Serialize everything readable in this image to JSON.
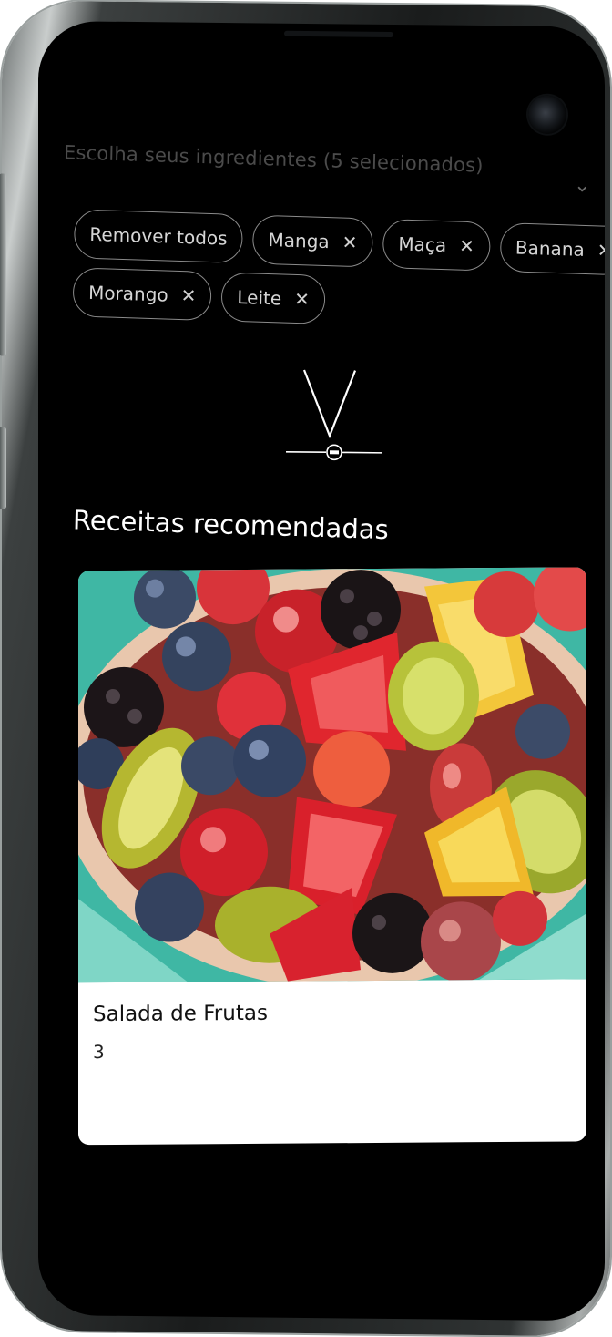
{
  "filter": {
    "label": "Escolha seus ingredientes (5 selecionados)",
    "chevron_icon": "chevron-down-icon"
  },
  "chips": {
    "clear_label": "Remover todos",
    "row1": [
      "Manga",
      "Maça",
      "Banana"
    ],
    "row2": [
      "Morango",
      "Leite"
    ],
    "remove_icon": "close-icon",
    "remove_glyph": "✕"
  },
  "section": {
    "title": "Receitas recomendadas"
  },
  "recipe": {
    "title": "Salada de Frutas",
    "count": "3",
    "image_desc": "fruit-salad-bowl"
  }
}
